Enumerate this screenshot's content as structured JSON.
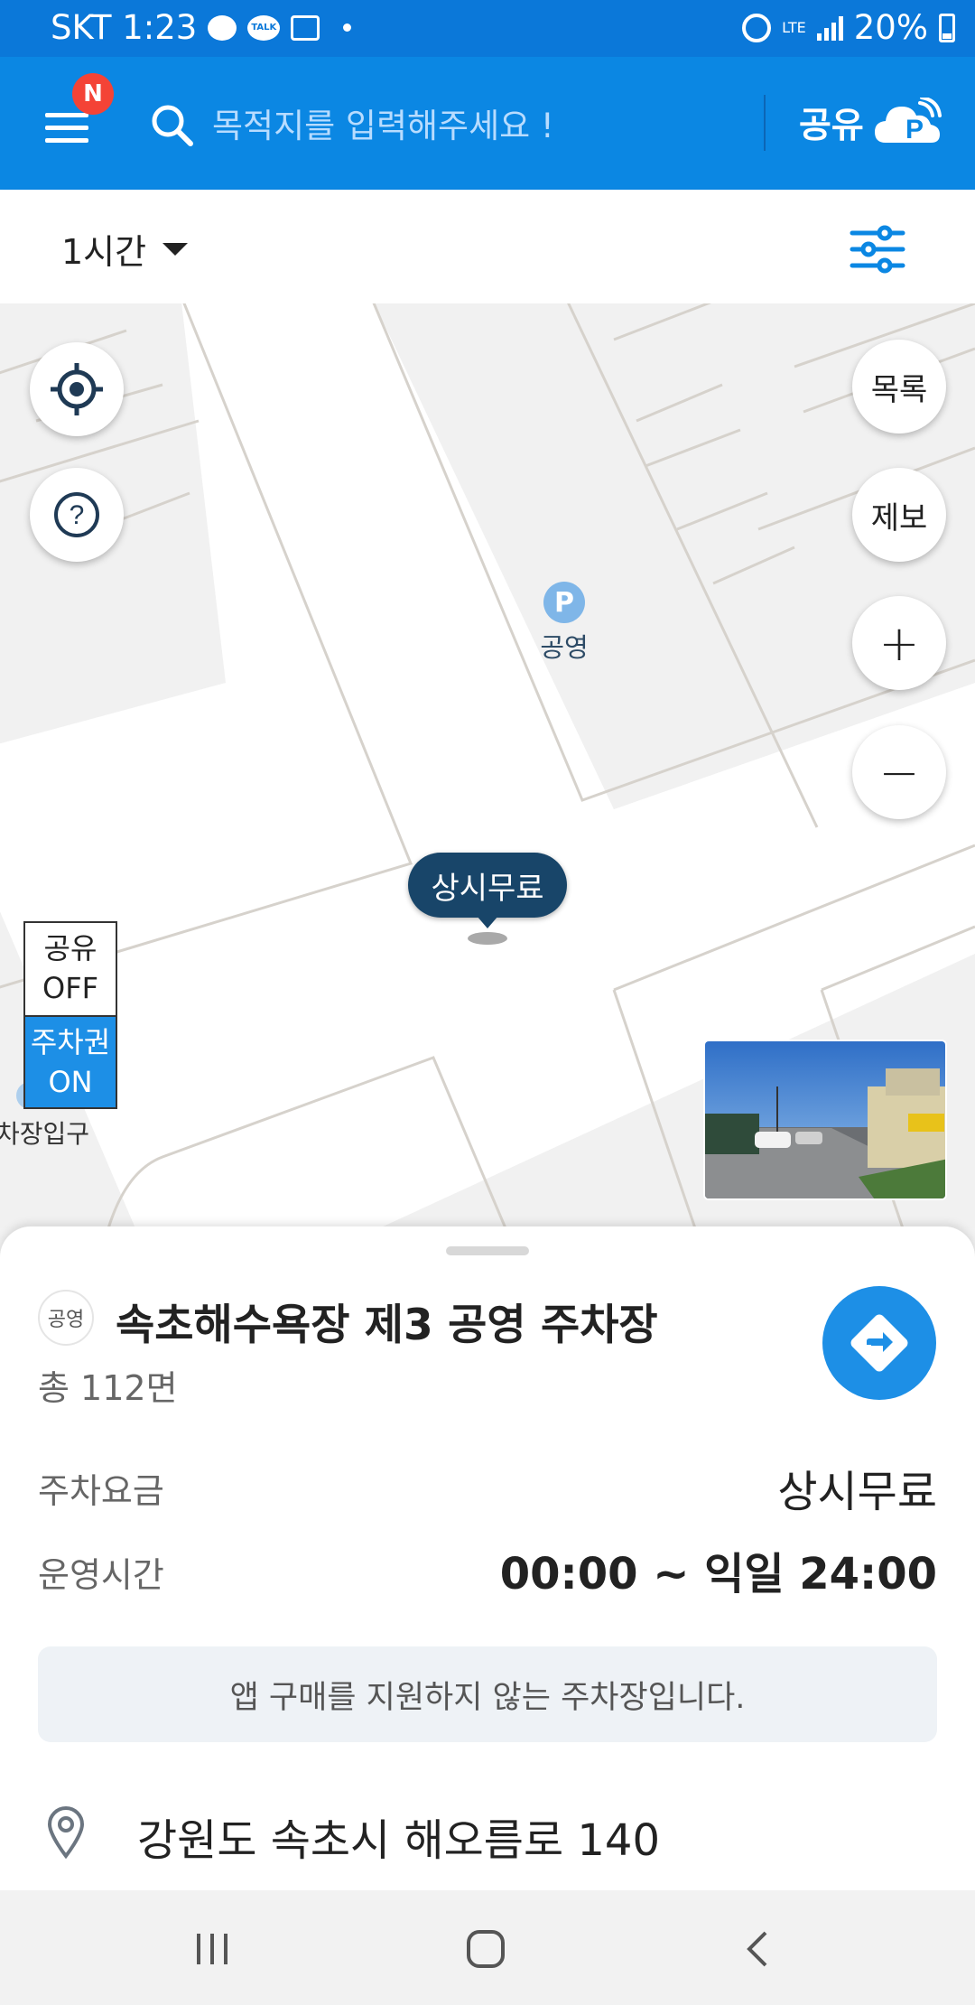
{
  "status_bar": {
    "carrier_time": "SKT 1:23",
    "talk_label": "TALK",
    "network": "LTE",
    "battery": "20%"
  },
  "header": {
    "badge": "N",
    "search_placeholder": "목적지를 입력해주세요 !",
    "share_label": "공유",
    "accent_color": "#0b87e3"
  },
  "filter_bar": {
    "time_value": "1시간"
  },
  "map": {
    "buttons": {
      "list": "목록",
      "report": "제보",
      "zoom_in": "+",
      "zoom_out": "−"
    },
    "poi": {
      "marker": "P",
      "label": "공영"
    },
    "selected_callout": "상시무료",
    "toggles": {
      "share_title": "공유",
      "share_state": "OFF",
      "ticket_title": "주차권",
      "ticket_state": "ON"
    },
    "entrance_label": "차장입구"
  },
  "sheet": {
    "type_badge": "공영",
    "lot_name": "속초해수욕장 제3 공영 주차장",
    "capacity": "총 112면",
    "fee_label": "주차요금",
    "fee_value": "상시무료",
    "hours_label": "운영시간",
    "hours_value": "00:00 ~ 익일 24:00",
    "notice": "앱 구매를 지원하지 않는 주차장입니다.",
    "address": "강원도 속초시 해오름로 140"
  }
}
